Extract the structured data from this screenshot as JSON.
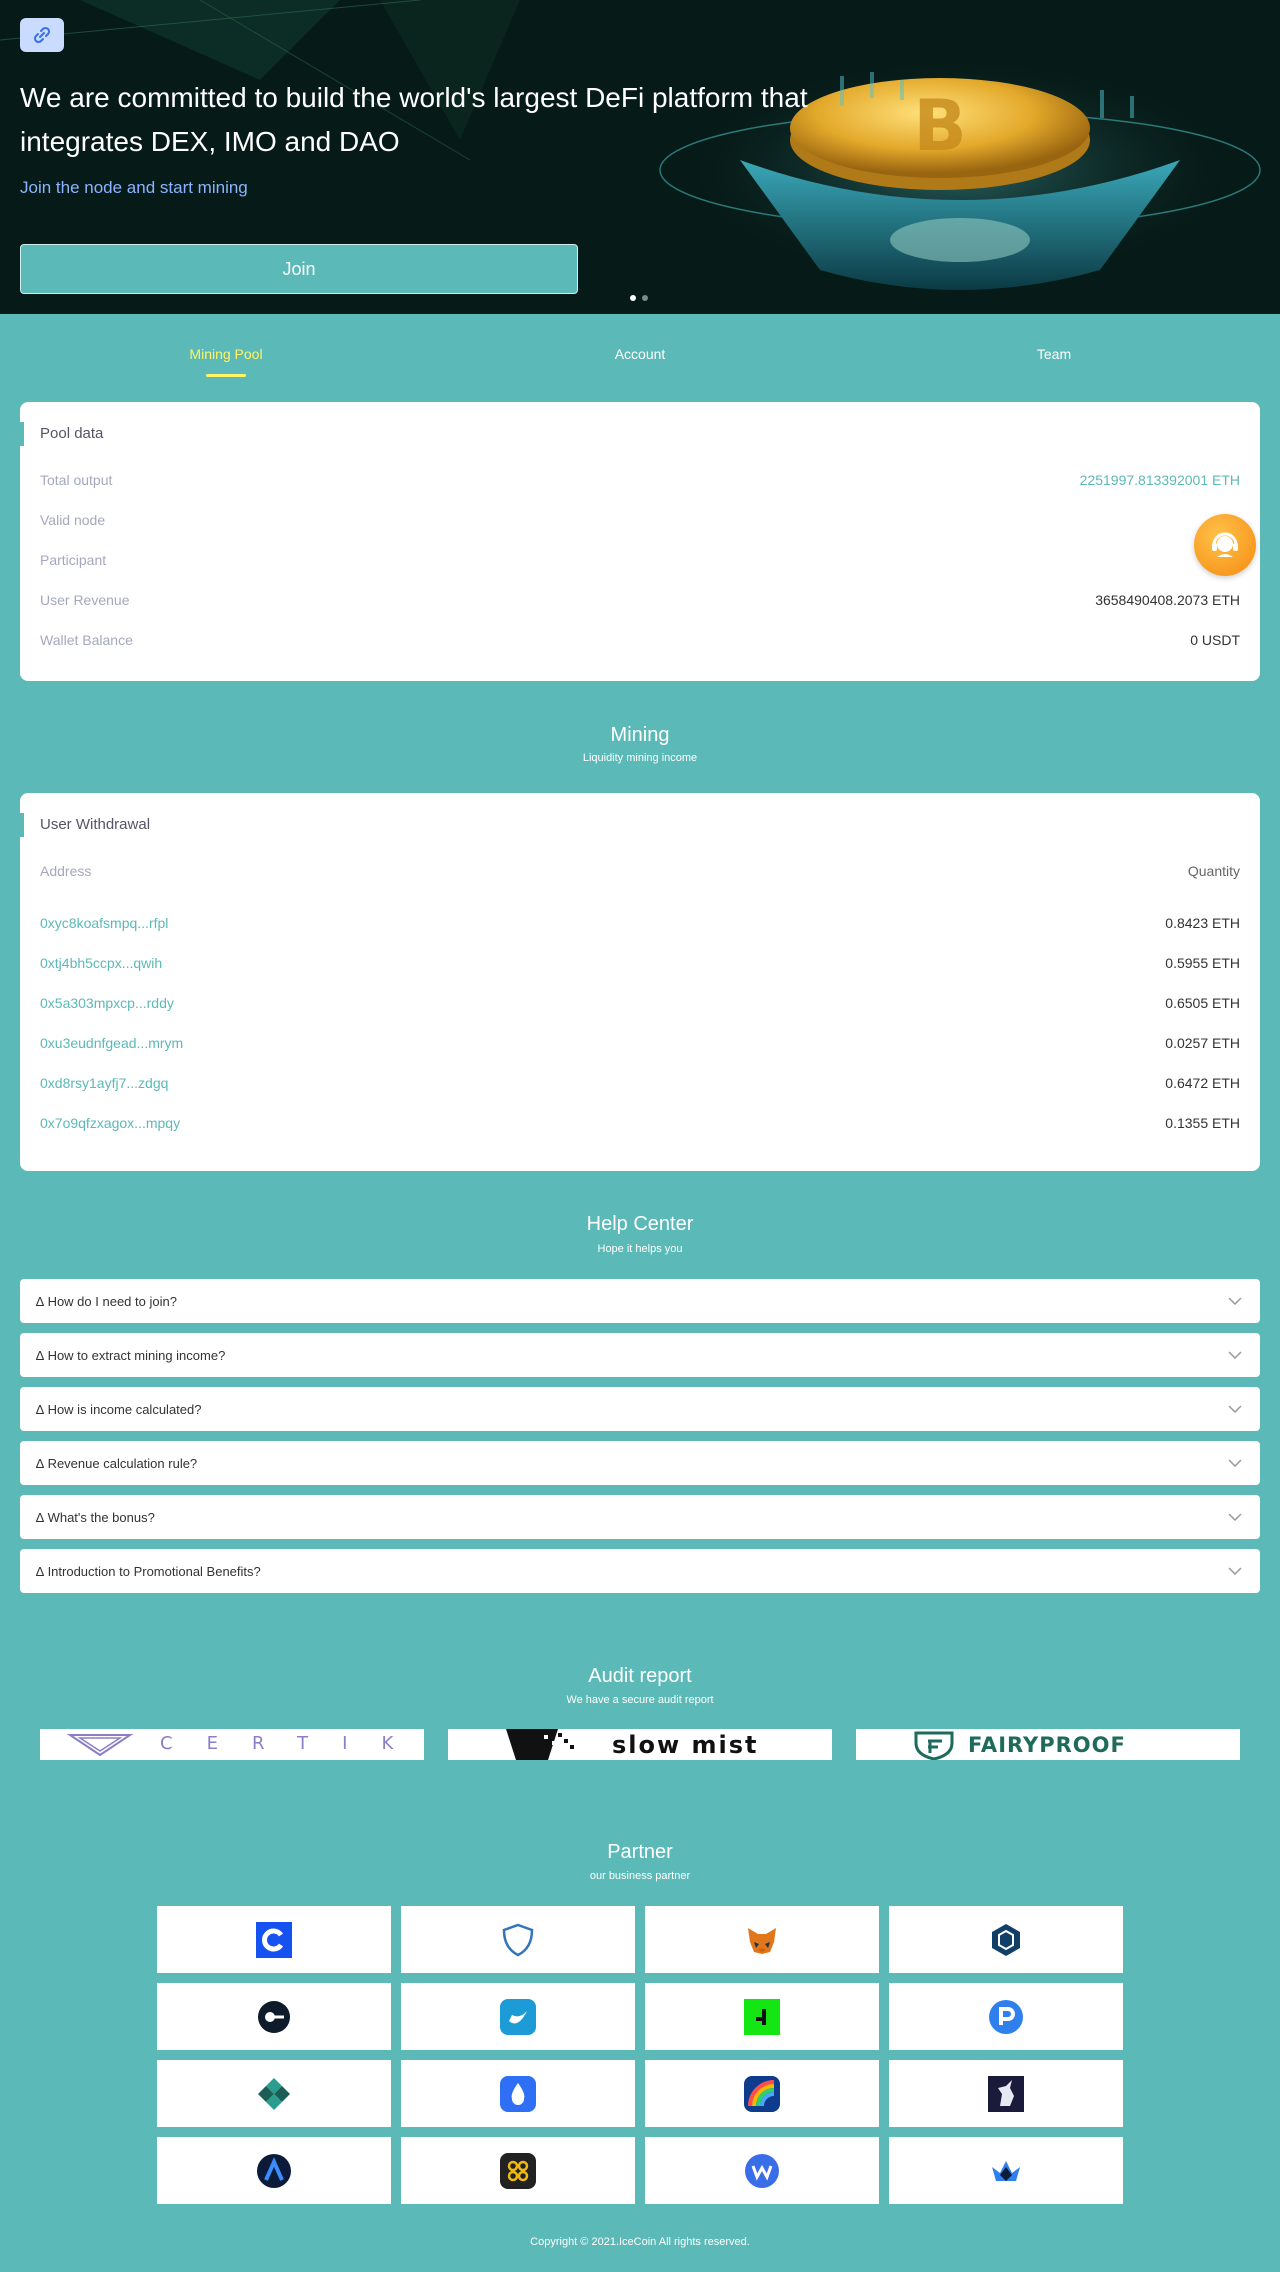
{
  "hero": {
    "title": "We are committed to build the world's largest DeFi platform that integrates DEX, IMO and DAO",
    "subtitle": "Join the node and start mining",
    "join_label": "Join",
    "link_icon": "link-icon"
  },
  "tabs": [
    {
      "label": "Mining Pool",
      "active": true
    },
    {
      "label": "Account",
      "active": false
    },
    {
      "label": "Team",
      "active": false
    }
  ],
  "pool": {
    "title": "Pool data",
    "rows": [
      {
        "label": "Total output",
        "value": "2251997.813392001 ETH"
      },
      {
        "label": "Valid node",
        "value": ""
      },
      {
        "label": "Participant",
        "value": ""
      },
      {
        "label": "User Revenue",
        "value": "3658490408.2073 ETH"
      },
      {
        "label": "Wallet Balance",
        "value": "0 USDT"
      }
    ]
  },
  "mining": {
    "title": "Mining",
    "subtitle": "Liquidity mining income"
  },
  "withdrawal": {
    "title": "User Withdrawal",
    "col_address": "Address",
    "col_quantity": "Quantity",
    "rows": [
      {
        "address": "0xyc8koafsmpq...rfpl",
        "quantity": "0.8423 ETH"
      },
      {
        "address": "0xtj4bh5ccpx...qwih",
        "quantity": "0.5955 ETH"
      },
      {
        "address": "0x5a303mpxcp...rddy",
        "quantity": "0.6505 ETH"
      },
      {
        "address": "0xu3eudnfgead...mrym",
        "quantity": "0.0257 ETH"
      },
      {
        "address": "0xd8rsy1ayfj7...zdgq",
        "quantity": "0.6472 ETH"
      },
      {
        "address": "0x7o9qfzxagox...mpqy",
        "quantity": "0.1355 ETH"
      }
    ]
  },
  "help": {
    "title": "Help Center",
    "subtitle": "Hope it helps you",
    "items": [
      "∆ How do I need to join?",
      "∆ How to extract mining income?",
      "∆ How is income calculated?",
      "∆ Revenue calculation rule?",
      "∆ What's the bonus?",
      "∆ Introduction to Promotional Benefits?"
    ]
  },
  "audit": {
    "title": "Audit report",
    "subtitle": "We have a secure audit report",
    "logos": [
      "CERTIK",
      "slow mist",
      "FAIRYPROOF"
    ]
  },
  "partner": {
    "title": "Partner",
    "subtitle": "our business partner",
    "logos": [
      "coinbase-logo",
      "trust-wallet-logo",
      "metamask-logo",
      "crypto-com-logo",
      "circle-logo",
      "bitkeep-logo",
      "green-wallet-logo",
      "pundix-logo",
      "diamond-logo",
      "drop-logo",
      "rainbow-logo",
      "unicorn-logo",
      "a-logo",
      "infinity-logo",
      "w-logo",
      "crown-logo"
    ]
  },
  "footer": {
    "copyright": "Copyright © 2021.IceCoin All rights reserved."
  },
  "colors": {
    "teal": "#5bb9b7",
    "active_tab": "#fff566",
    "hero_bg": "#061a17",
    "support_orange": "#f58a10"
  }
}
